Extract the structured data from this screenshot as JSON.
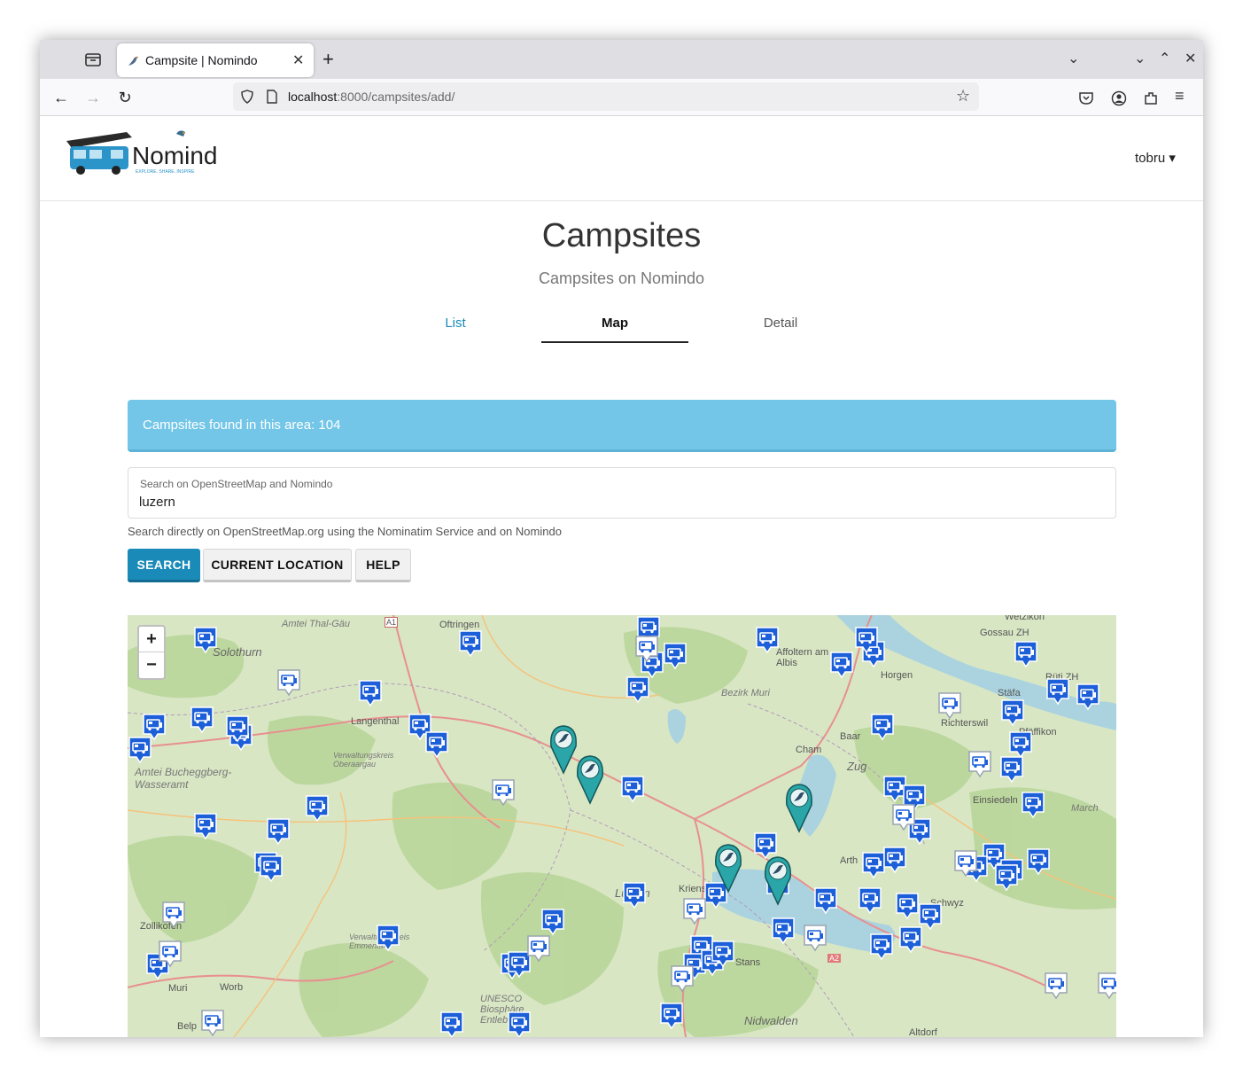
{
  "browser": {
    "tab_title": "Campsite | Nomindo",
    "new_tab": "+",
    "url_host": "localhost",
    "url_path": ":8000/campsites/add/"
  },
  "header": {
    "logo_text": "Nomindo",
    "logo_tagline": "EXPLORE. SHARE. INSPIRE",
    "user": "tobru"
  },
  "page": {
    "title": "Campsites",
    "subtitle": "Campsites on Nomindo",
    "tabs": [
      {
        "label": "List",
        "active": false
      },
      {
        "label": "Map",
        "active": true
      },
      {
        "label": "Detail",
        "active": false
      }
    ]
  },
  "alert": {
    "text": "Campsites found in this area: 104"
  },
  "search": {
    "label": "Search on OpenStreetMap and Nomindo",
    "value": "luzern",
    "help": "Search directly on OpenStreetMap.org using the Nominatim Service and on Nomindo"
  },
  "buttons": {
    "search": "SEARCH",
    "current_location": "CURRENT LOCATION",
    "help": "HELP"
  },
  "map": {
    "zoom_in": "+",
    "zoom_out": "−",
    "labels": [
      "Amtei Thal-Gäu",
      "Solothurn",
      "Oftringen",
      "Langenthal",
      "Amtei Bucheggberg-Wasseramt",
      "Verwaltungskreis Oberaargau",
      "Bezirk Muri",
      "Affoltern am Albis",
      "Horgen",
      "Gossau ZH",
      "Wetzikon",
      "Rüti ZH",
      "Stäfa",
      "Richterswil",
      "Pfäffikon",
      "Baar",
      "Cham",
      "Zug",
      "Einsiedeln",
      "March",
      "Arth",
      "Schwyz",
      "Luzern",
      "Kriens",
      "Stans",
      "Nidwalden",
      "Altdorf",
      "Zollikofen",
      "Muri",
      "Worb",
      "Belp",
      "UNESCO Biosphäre Entlebuch",
      "Verwaltungskreis Emmental",
      "A1",
      "A2"
    ],
    "colors": {
      "marker_blue": "#1c5fd8",
      "marker_white": "#ffffff",
      "pin_teal": "#2aa6a8",
      "water": "#aad3df"
    }
  }
}
